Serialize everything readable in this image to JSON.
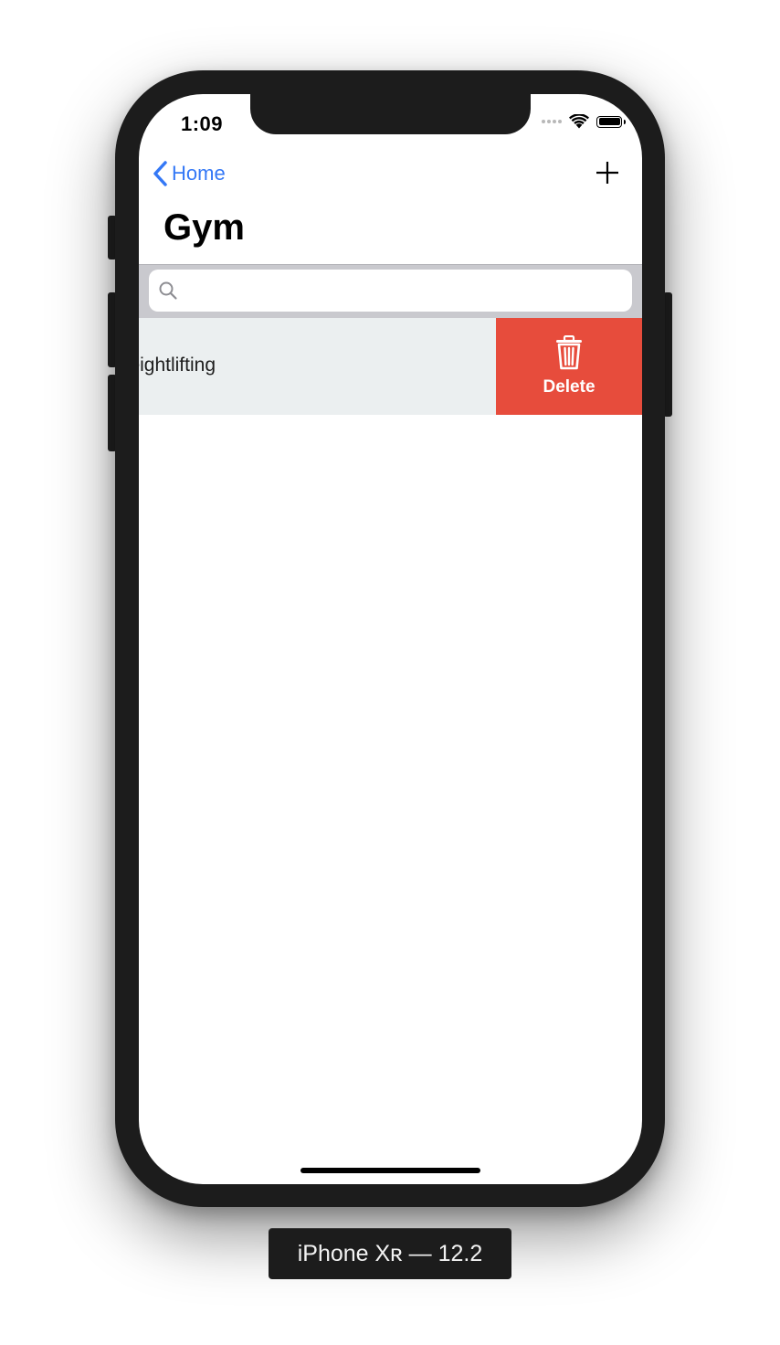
{
  "status_bar": {
    "time": "1:09",
    "icons": [
      "cellular-signal-icon",
      "wifi-icon",
      "battery-icon"
    ]
  },
  "nav": {
    "back_label": "Home",
    "back_icon": "chevron-left-icon",
    "add_icon": "plus-icon",
    "title": "Gym"
  },
  "search": {
    "placeholder": "",
    "value": "",
    "icon": "search-icon"
  },
  "list": {
    "rows": [
      {
        "label": "Weightlifting",
        "visible_fragment": "ng"
      }
    ]
  },
  "swipe_action": {
    "label": "Delete",
    "icon": "trash-icon",
    "color": "#e74c3c"
  },
  "device": {
    "caption": "iPhone Xʀ — 12.2"
  },
  "colors": {
    "accent": "#3478f6",
    "row_background": "#ebeff0",
    "search_bar_background": "#c9c9ce",
    "device_frame": "#1c1c1c"
  }
}
